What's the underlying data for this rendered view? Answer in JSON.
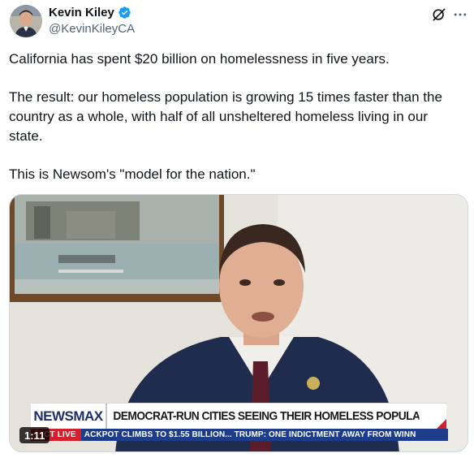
{
  "author": {
    "display_name": "Kevin Kiley",
    "handle": "@KevinKileyCA",
    "verified": true,
    "verified_color": "#1d9bf0"
  },
  "tweet": {
    "paragraphs": [
      "California has spent $20 billion on homelessness in five years.",
      "The result: our homeless population is growing 15 times faster than the country as a whole, with half of all unsheltered homeless living in our state.",
      "This is Newsom's \"model for the nation.\""
    ]
  },
  "media": {
    "duration": "1:11",
    "broadcast": {
      "network": "NEWSMAX",
      "headline": "DEMOCRAT-RUN CITIES SEEING THEIR HOMELESS POPULATION RISING",
      "live_badge": "CT LIVE",
      "ticker": "ACKPOT CLIMBS TO $1.55 BILLION...     TRUMP: ONE INDICTMENT AWAY FROM WINN",
      "accent_color": "#d3202a",
      "ticker_color": "#1d3d8a"
    }
  },
  "icons": {
    "grok": "grok-icon",
    "more": "more-icon"
  }
}
